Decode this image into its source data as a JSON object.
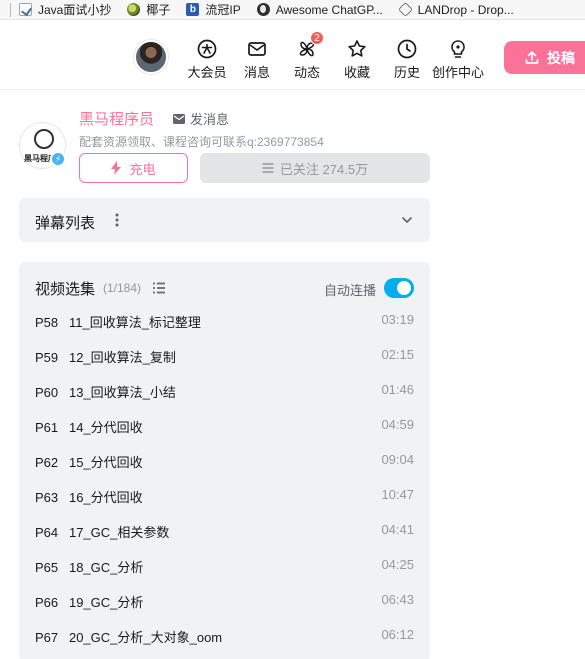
{
  "bookmarks": [
    {
      "icon": "java-doc-icon",
      "label": "Java面试小抄"
    },
    {
      "icon": "coconut-icon",
      "label": "椰子"
    },
    {
      "icon": "ip-icon",
      "label": "流冠IP"
    },
    {
      "icon": "globe-icon",
      "label": "Awesome ChatGP..."
    },
    {
      "icon": "landrop-icon",
      "label": "LANDrop - Drop..."
    }
  ],
  "header": {
    "nav": [
      {
        "icon": "vip-icon",
        "label": "大会员"
      },
      {
        "icon": "message-icon",
        "label": "消息"
      },
      {
        "icon": "dynamic-icon",
        "label": "动态",
        "badge": "2"
      },
      {
        "icon": "star-icon",
        "label": "收藏"
      },
      {
        "icon": "history-icon",
        "label": "历史"
      },
      {
        "icon": "lightbulb-icon",
        "label": "创作中心"
      }
    ],
    "upload_label": "投稿"
  },
  "up": {
    "name": "黑马程序员",
    "message_label": "发消息",
    "description": "配套资源领取、课程咨询可联系q:2369773854",
    "avatar_text": "黑马程序",
    "charge_label": "充电",
    "follow_label": "已关注 274.5万"
  },
  "danmaku": {
    "title": "弹幕列表"
  },
  "episodes": {
    "title": "视频选集",
    "count": "(1/184)",
    "autoplay_label": "自动连播",
    "autoplay_on": true,
    "items": [
      {
        "label": "P58   11_回收算法_标记整理",
        "duration": "03:19"
      },
      {
        "label": "P59   12_回收算法_复制",
        "duration": "02:15"
      },
      {
        "label": "P60   13_回收算法_小结",
        "duration": "01:46"
      },
      {
        "label": "P61   14_分代回收",
        "duration": "04:59"
      },
      {
        "label": "P62   15_分代回收",
        "duration": "09:04"
      },
      {
        "label": "P63   16_分代回收",
        "duration": "10:47"
      },
      {
        "label": "P64   17_GC_相关参数",
        "duration": "04:41"
      },
      {
        "label": "P65   18_GC_分析",
        "duration": "04:25"
      },
      {
        "label": "P66   19_GC_分析",
        "duration": "06:43"
      },
      {
        "label": "P67   20_GC_分析_大对象_oom",
        "duration": "06:12"
      }
    ]
  },
  "colors": {
    "accent_pink": "#fb7299",
    "accent_blue": "#00aeec",
    "panel_bg": "#f1f2f3"
  }
}
